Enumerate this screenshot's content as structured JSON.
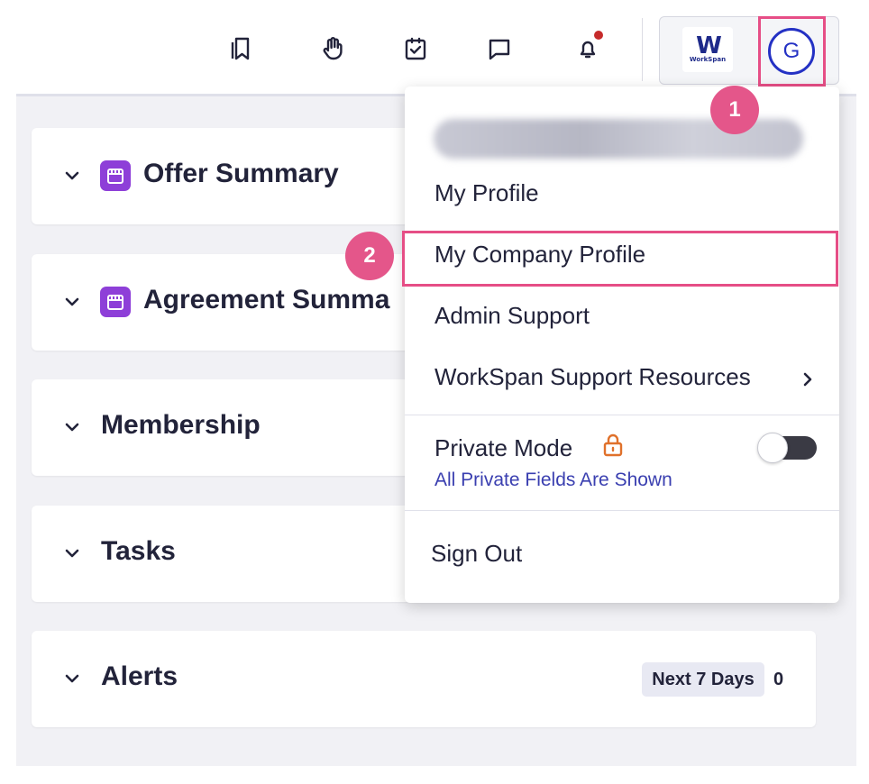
{
  "toolbar": {
    "icons": [
      "bookmarks-icon",
      "raise-hand-icon",
      "task-checklist-icon",
      "chat-icon",
      "notifications-icon"
    ],
    "notification_dot_color": "#c62b2b"
  },
  "account": {
    "company_logo_mark": "W",
    "company_logo_text": "WorkSpan",
    "avatar_initial": "G",
    "avatar_color": "#2431c4"
  },
  "sections": [
    {
      "title": "Offer Summary",
      "icon": "storefront-icon"
    },
    {
      "title": "Agreement Summa",
      "icon": "storefront-icon"
    },
    {
      "title": "Membership"
    },
    {
      "title": "Tasks"
    },
    {
      "title": "Alerts",
      "badge": "Next 7 Days",
      "count": "0"
    }
  ],
  "profile_menu": {
    "user_name_redacted": true,
    "items": [
      {
        "label": "My Profile"
      },
      {
        "label": "My Company Profile",
        "highlighted": true
      },
      {
        "label": "Admin Support"
      },
      {
        "label": "WorkSpan Support Resources",
        "has_submenu": true
      }
    ],
    "private_mode": {
      "label": "Private Mode",
      "sublabel": "All Private Fields Are Shown",
      "enabled": false,
      "lock_color": "#e0712b"
    },
    "sign_out_label": "Sign Out"
  },
  "callouts": [
    "1",
    "2"
  ],
  "colors": {
    "highlight": "#e64e86",
    "callout": "#e4568a",
    "section_icon": "#8e3fd8",
    "link_text": "#3a3fb0"
  }
}
